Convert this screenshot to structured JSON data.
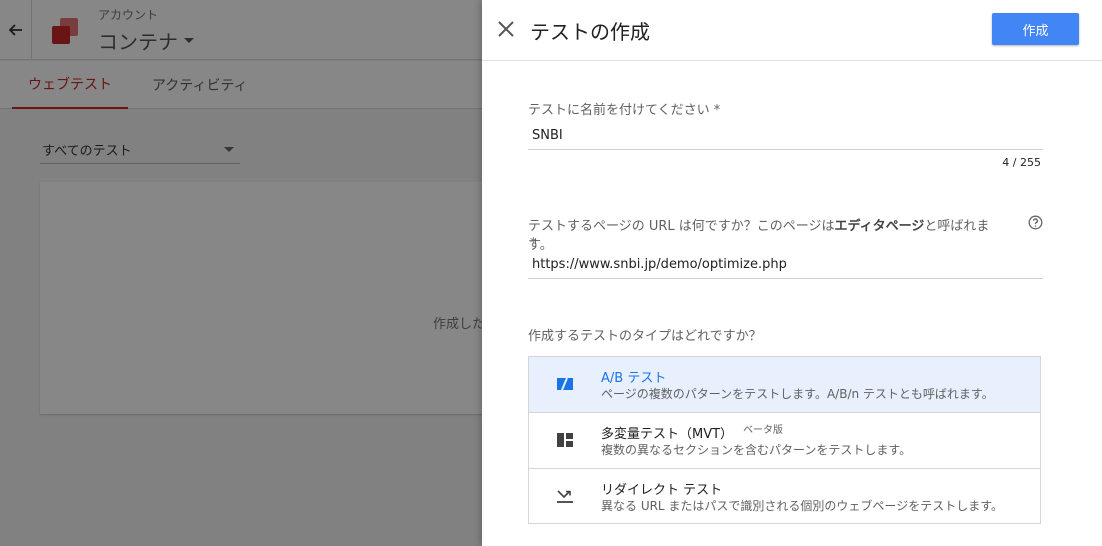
{
  "background": {
    "account_label": "アカウント",
    "container_name": "コンテナ",
    "tabs": [
      {
        "label": "ウェブテスト",
        "active": true
      },
      {
        "label": "アクティビティ",
        "active": false
      }
    ],
    "filter_value": "すべてのテスト",
    "empty_text": "作成した"
  },
  "dialog": {
    "title": "テストの作成",
    "create_label": "作成",
    "name_field": {
      "label": "テストに名前を付けてください *",
      "value": "SNBI",
      "count": "4 / 255"
    },
    "url_field": {
      "label_pre": "テストするページの URL は何ですか？このページは",
      "label_bold": "エディタページ",
      "label_post": "と呼ばれます。",
      "required": "*",
      "value": "https://www.snbi.jp/demo/optimize.php"
    },
    "type_question": "作成するテストのタイプはどれですか？",
    "types": [
      {
        "title": "A/B テスト",
        "beta": "",
        "desc": "ページの複数のパターンをテストします。A/B/n テストとも呼ばれます。",
        "icon": "ab-test-icon",
        "selected": true
      },
      {
        "title": "多変量テスト（MVT）",
        "beta": "ベータ版",
        "desc": "複数の異なるセクションを含むパターンをテストします。",
        "icon": "mvt-grid-icon",
        "selected": false
      },
      {
        "title": "リダイレクト テスト",
        "beta": "",
        "desc": "異なる URL またはパスで識別される個別のウェブページをテストします。",
        "icon": "redirect-icon",
        "selected": false
      }
    ]
  },
  "colors": {
    "accent": "#4285f4",
    "active_tab": "#c62828",
    "selected_bg": "#e8f0fe",
    "selected_text": "#1a73e8"
  }
}
